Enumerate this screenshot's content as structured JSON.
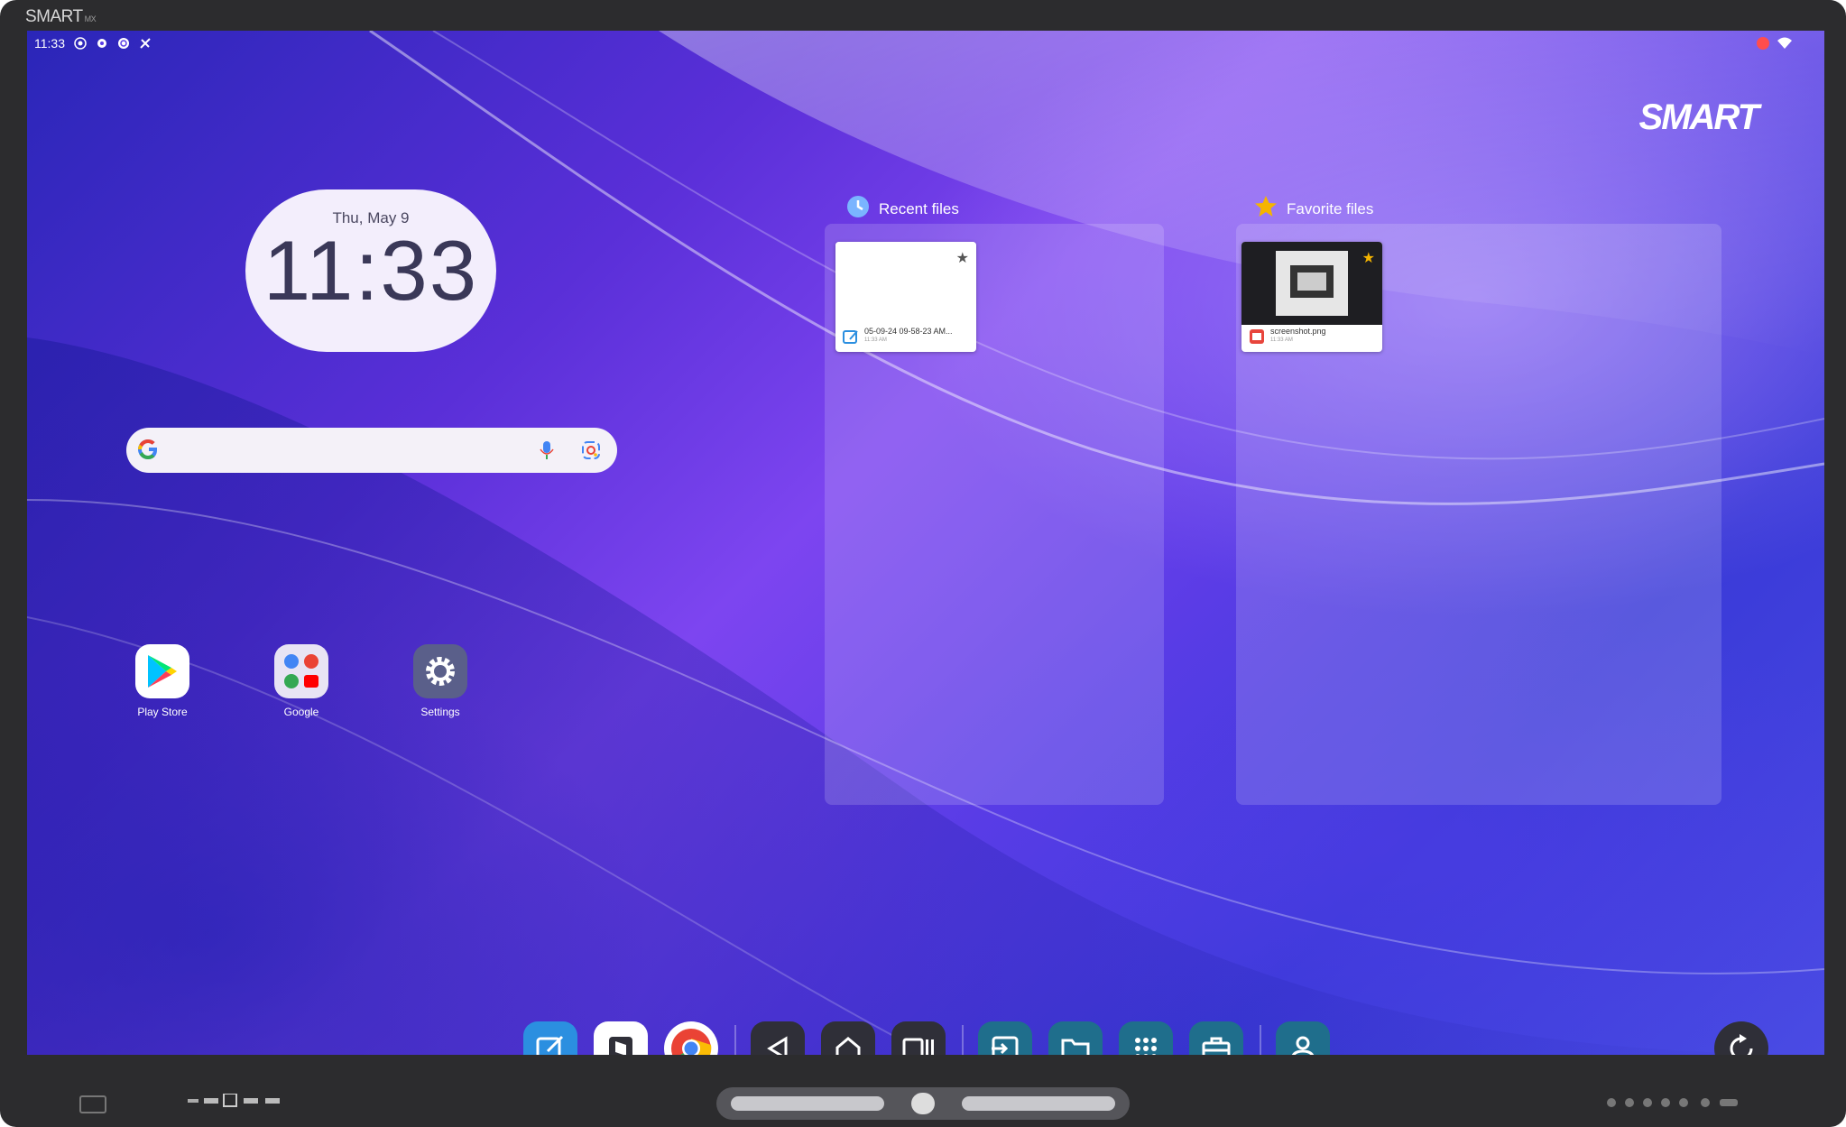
{
  "bezel": {
    "brand": "SMART",
    "model": "MX"
  },
  "statusbar": {
    "time": "11:33"
  },
  "wallpaper_logo": "SMART",
  "clock": {
    "date": "Thu, May 9",
    "time": "11:33"
  },
  "search": {
    "placeholder": ""
  },
  "recent_files": {
    "title": "Recent files",
    "items": [
      {
        "name": "05-09-24 09-58-23 AM...",
        "sub": "11:33 AM"
      }
    ]
  },
  "favorite_files": {
    "title": "Favorite files",
    "items": [
      {
        "name": "screenshot.png",
        "sub": "11:33 AM"
      }
    ]
  },
  "apps": [
    {
      "label": "Play Store",
      "icon": "play-store-icon"
    },
    {
      "label": "Google",
      "icon": "google-folder-icon"
    },
    {
      "label": "Settings",
      "icon": "settings-gear-icon"
    }
  ],
  "dock": {
    "items": [
      "whiteboard-icon",
      "smart-notebook-icon",
      "chrome-icon",
      "back-icon",
      "home-icon",
      "recents-icon",
      "input-icon",
      "files-icon",
      "apps-grid-icon",
      "toolbox-icon",
      "account-icon"
    ],
    "right": "rotate-icon"
  },
  "colors": {
    "wallpaper_primary": "#5a2fd8",
    "bezel": "#2c2c2e",
    "accent_star": "#f5b400"
  }
}
